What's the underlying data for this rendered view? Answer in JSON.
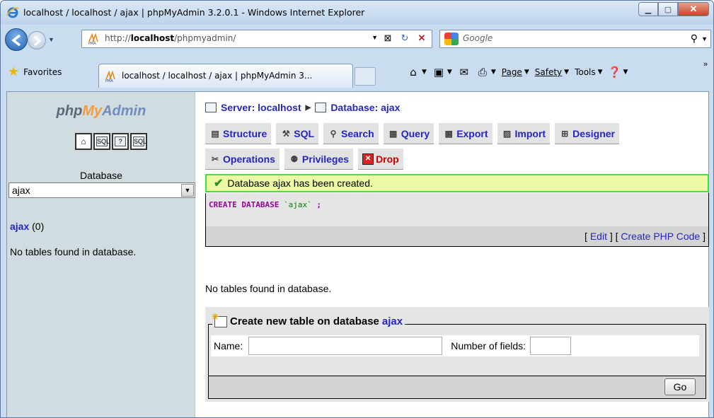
{
  "window": {
    "title": "localhost / localhost / ajax | phpMyAdmin 3.2.0.1 - Windows Internet Explorer"
  },
  "address_bar": {
    "url_prefix": "http://",
    "url_host": "localhost",
    "url_path": "/phpmyadmin/",
    "search_placeholder": "Google"
  },
  "command_bar": {
    "favorites_label": "Favorites",
    "tab_title": "localhost / localhost / ajax | phpMyAdmin 3...",
    "page_label": "Page",
    "safety_label": "Safety",
    "tools_label": "Tools"
  },
  "left_frame": {
    "logo": {
      "php": "php",
      "my": "My",
      "admin": "Admin"
    },
    "icons": [
      "home-icon",
      "sql-query-icon",
      "help-icon",
      "sql-docs-icon"
    ],
    "database_label": "Database",
    "database_selected": "ajax",
    "db_link": "ajax",
    "db_count": "(0)",
    "no_tables": "No tables found in database."
  },
  "right_frame": {
    "breadcrumb": {
      "server": "Server: localhost",
      "database": "Database: ajax"
    },
    "tabs_row1": [
      {
        "label": "Structure",
        "icon": "structure-icon"
      },
      {
        "label": "SQL",
        "icon": "sql-icon"
      },
      {
        "label": "Search",
        "icon": "search-icon"
      },
      {
        "label": "Query",
        "icon": "query-icon"
      },
      {
        "label": "Export",
        "icon": "export-icon"
      },
      {
        "label": "Import",
        "icon": "import-icon"
      },
      {
        "label": "Designer",
        "icon": "designer-icon"
      }
    ],
    "tabs_row2": [
      {
        "label": "Operations",
        "icon": "operations-icon"
      },
      {
        "label": "Privileges",
        "icon": "privileges-icon"
      },
      {
        "label": "Drop",
        "icon": "drop-icon"
      }
    ],
    "notice": "Database ajax has been created.",
    "sql": {
      "keyword": "CREATE DATABASE",
      "name": "`ajax`",
      "end": ";"
    },
    "sql_links": {
      "edit": "Edit",
      "create_php": "Create PHP Code"
    },
    "no_tables": "No tables found in database.",
    "create_table": {
      "legend_prefix": "Create new table on database",
      "legend_db": "ajax",
      "name_label": "Name:",
      "name_value": "",
      "fields_label": "Number of fields:",
      "fields_value": "",
      "go_label": "Go"
    }
  },
  "colors": {
    "link": "#2525c2",
    "notice_border": "#3be23b",
    "notice_bg": "#ebf8a4",
    "panel_bg": "#d0dce0",
    "sql_keyword": "#990099"
  }
}
